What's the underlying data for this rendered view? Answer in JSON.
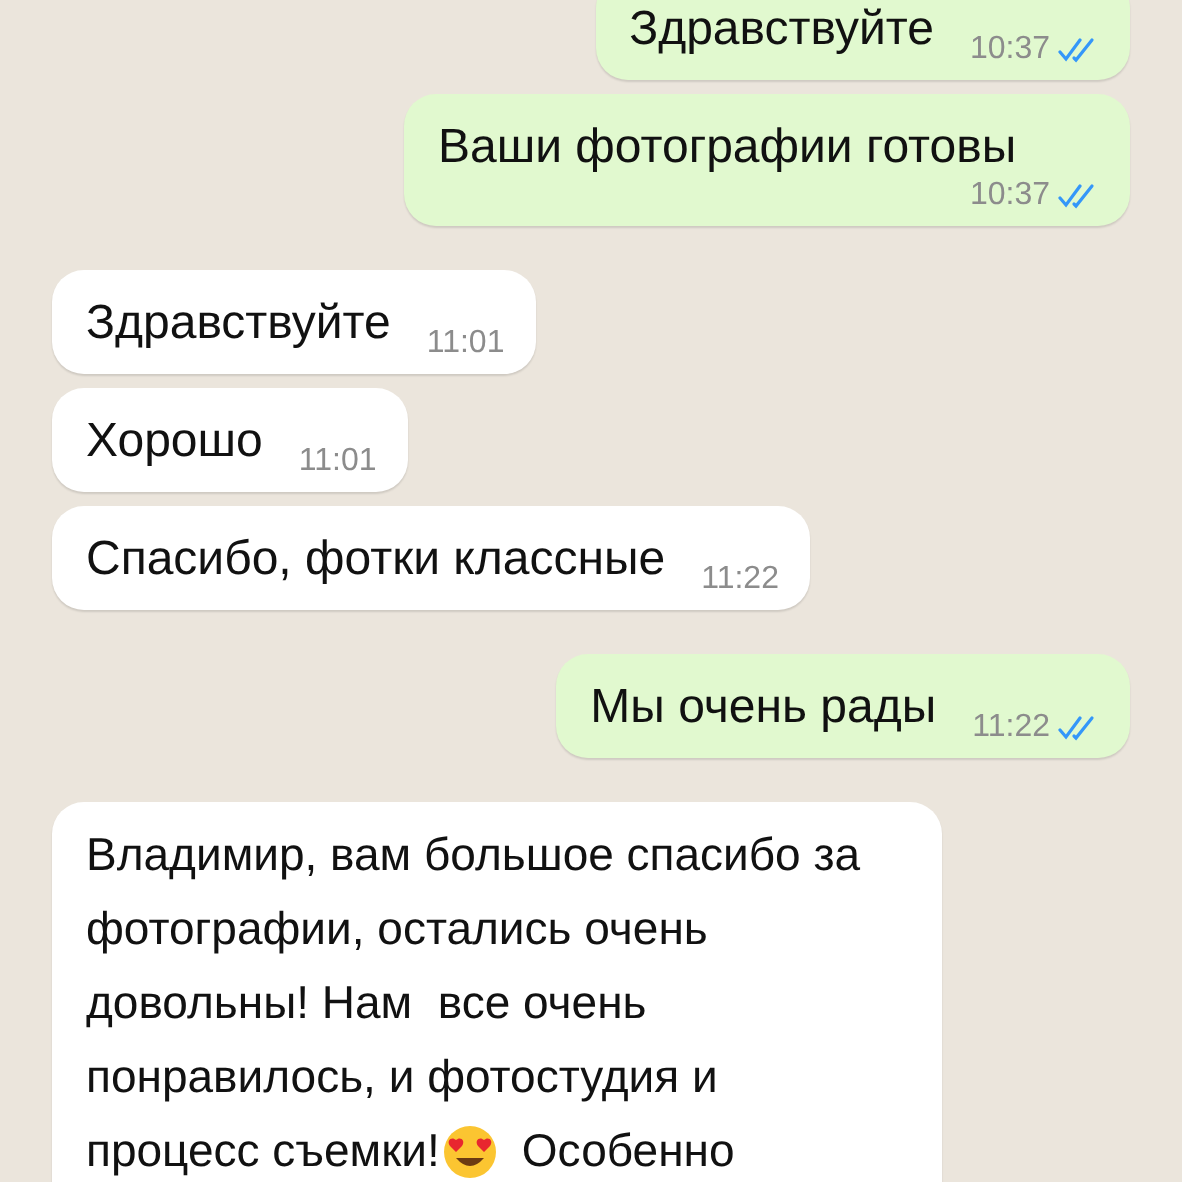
{
  "messages": [
    {
      "kind": "outgoing",
      "text": "Здравствуйте",
      "time": "10:37",
      "read": true
    },
    {
      "kind": "outgoing",
      "text": "Ваши фотографии готовы",
      "time": "10:37",
      "read": true
    },
    {
      "kind": "incoming",
      "text": "Здравствуйте",
      "time": "11:01"
    },
    {
      "kind": "incoming",
      "text": "Хорошо",
      "time": "11:01"
    },
    {
      "kind": "incoming",
      "text": "Спасибо, фотки классные",
      "time": "11:22"
    },
    {
      "kind": "outgoing",
      "text": "Мы очень рады",
      "time": "11:22",
      "read": true
    },
    {
      "kind": "incoming",
      "parts": [
        {
          "kind": "text",
          "text": "Владимир, вам большое спасибо за фотографии, остались очень довольны! Нам  все очень понравилось, и фотостудия и"
        },
        {
          "kind": "text",
          "text": "процесс съемки!"
        },
        {
          "kind": "emoji"
        },
        {
          "kind": "text",
          "text": "Особенно"
        }
      ]
    }
  ]
}
